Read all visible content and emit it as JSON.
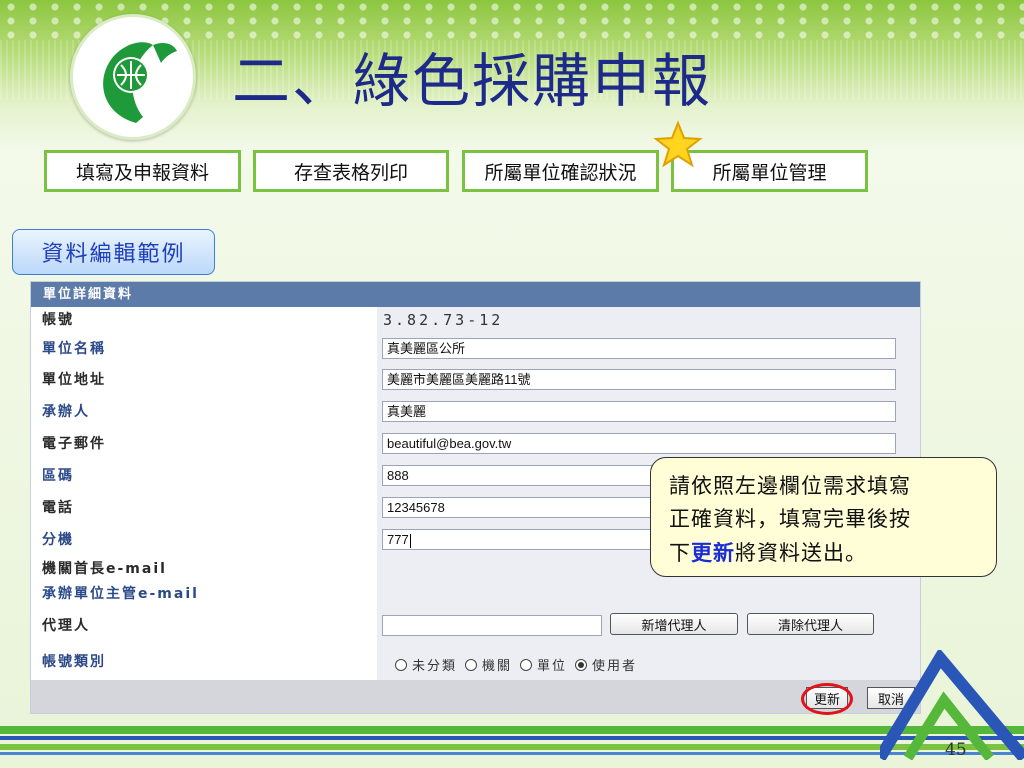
{
  "slide": {
    "title": "二、綠色採購申報",
    "page_number": "45"
  },
  "nav": {
    "items": [
      "填寫及申報資料",
      "存查表格列印",
      "所屬單位確認狀況",
      "所屬單位管理"
    ]
  },
  "example_tag": "資料編輯範例",
  "form": {
    "header": "單位詳細資料",
    "account_label": "帳號",
    "account_value": "3.82.73-12",
    "fields": [
      {
        "label": "單位名稱",
        "value": "真美麗區公所"
      },
      {
        "label": "單位地址",
        "value": "美麗市美麗區美麗路11號"
      },
      {
        "label": "承辦人",
        "value": "真美麗"
      },
      {
        "label": "電子郵件",
        "value": "beautiful@bea.gov.tw"
      },
      {
        "label": "區碼",
        "value": "888"
      },
      {
        "label": "電話",
        "value": "12345678"
      },
      {
        "label": "分機",
        "value": "777"
      }
    ],
    "head_email_label": "機關首長e-mail",
    "supervisor_email_label": "承辦單位主管e-mail",
    "agent_label": "代理人",
    "add_agent_button": "新增代理人",
    "clear_agent_button": "清除代理人",
    "account_type_label": "帳號類別",
    "account_type_options": [
      "未分類",
      "機關",
      "單位",
      "使用者"
    ],
    "account_type_selected": "使用者",
    "update_button": "更新",
    "cancel_button": "取消"
  },
  "callout": {
    "line1": "請依照左邊欄位需求填寫",
    "line2": "正確資料，填寫完畢後按",
    "line3_prefix": "下",
    "line3_emphasis": "更新",
    "line3_suffix": "將資料送出。"
  },
  "colors": {
    "title": "#1d2a8a",
    "nav_border": "#7cc242",
    "panel_header": "#5c7ba8",
    "highlight_circle": "#e0141a",
    "callout_emphasis": "#1b2dd4"
  },
  "icons": {
    "logo": "green-leaf-logo-icon",
    "star": "star-icon",
    "mountain": "mountain-decor-icon"
  }
}
